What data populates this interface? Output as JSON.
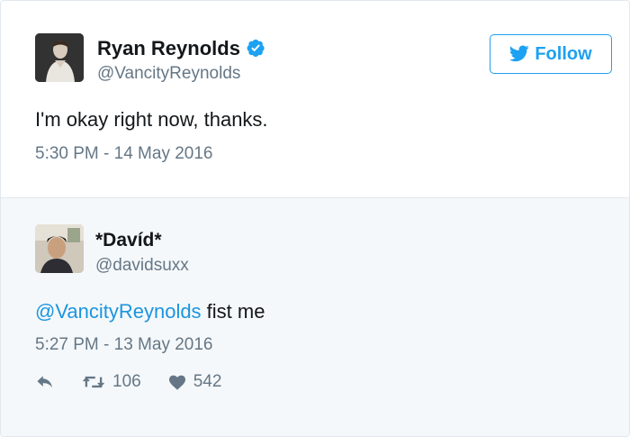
{
  "main_tweet": {
    "author_name": "Ryan Reynolds",
    "verified": true,
    "handle": "@VancityReynolds",
    "text": "I'm okay right now, thanks.",
    "timestamp": "5:30 PM - 14 May 2016",
    "follow_label": "Follow"
  },
  "reply_tweet": {
    "author_name": "*Davíd*",
    "handle": "@davidsuxx",
    "mention": "@VancityReynolds",
    "text": " fist me",
    "timestamp": "5:27 PM - 13 May 2016",
    "retweet_count": "106",
    "like_count": "542"
  },
  "colors": {
    "accent": "#1da1f2",
    "mention": "#1b95e0",
    "secondary_text": "#657786",
    "reply_background": "#f5f8fa"
  },
  "icons": [
    "verified-badge-icon",
    "twitter-bird-icon",
    "reply-icon",
    "retweet-icon",
    "like-heart-icon"
  ]
}
